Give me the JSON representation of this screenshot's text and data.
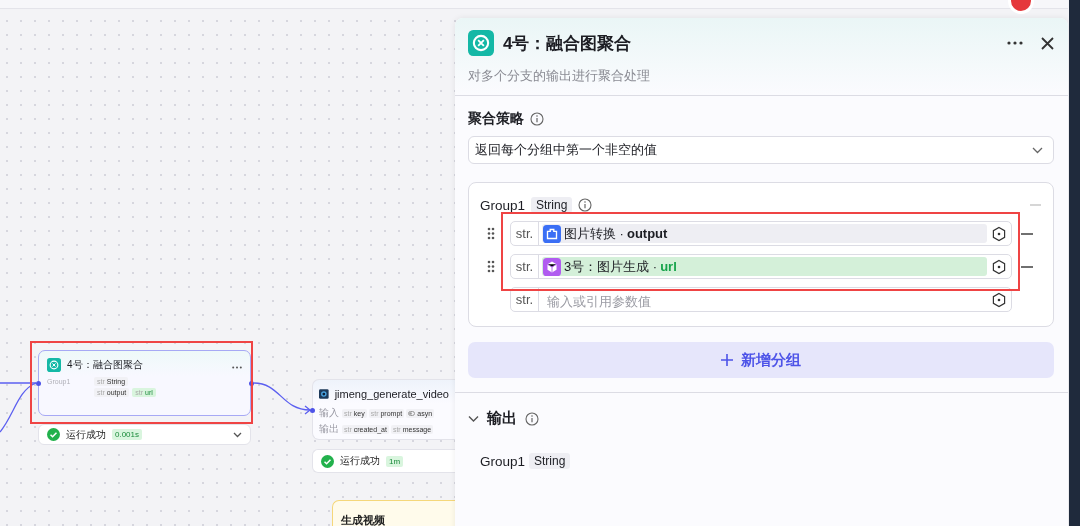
{
  "canvas": {
    "nodes": [
      {
        "kind": "merge",
        "title": "4号：融合图聚合",
        "selected": true,
        "group_label": "Group1",
        "rows": [
          [
            {
              "tag": "str",
              "name": "String",
              "matched": false
            }
          ],
          [
            {
              "tag": "str",
              "name": "output",
              "matched": false
            },
            {
              "tag": "str",
              "name": "url",
              "matched": true
            }
          ]
        ],
        "status": "运行成功",
        "duration": "0.001s",
        "expandable": true
      },
      {
        "kind": "plugin",
        "title": "jimeng_generate_video",
        "selected": false,
        "input_label": "输入",
        "inputs": [
          {
            "kind": "typed",
            "tag": "str",
            "name": "key"
          },
          {
            "kind": "typed",
            "tag": "str",
            "name": "prompt"
          },
          {
            "kind": "toggle",
            "name": "asyn"
          }
        ],
        "output_label": "输出",
        "outputs": [
          {
            "kind": "typed",
            "tag": "str",
            "name": "created_at"
          },
          {
            "kind": "typed",
            "tag": "str",
            "name": "message"
          }
        ],
        "status": "运行成功",
        "duration": "1m",
        "expandable": false
      },
      {
        "kind": "note",
        "title": "生成视频",
        "selected": false
      }
    ]
  },
  "panel": {
    "title": "4号：融合图聚合",
    "description": "对多个分支的输出进行聚合处理",
    "strategy": {
      "label": "聚合策略",
      "value": "返回每个分组中第一个非空的值"
    },
    "groups": [
      {
        "name": "Group1",
        "type": "String",
        "highlighted": true,
        "refs": [
          {
            "tag": "str.",
            "source": "图片转换",
            "separator": "·",
            "field": "output",
            "kind": "plugin",
            "matched": false
          },
          {
            "tag": "str.",
            "source": "3号：图片生成",
            "separator": "·",
            "field": "url",
            "kind": "cube",
            "matched": true
          }
        ],
        "empty_field": {
          "tag": "str.",
          "placeholder": "输入或引用参数值"
        }
      }
    ],
    "add_button": "新增分组",
    "output": {
      "label": "输出",
      "expanded": true,
      "items": [
        {
          "name": "Group1",
          "type": "String"
        }
      ]
    }
  }
}
